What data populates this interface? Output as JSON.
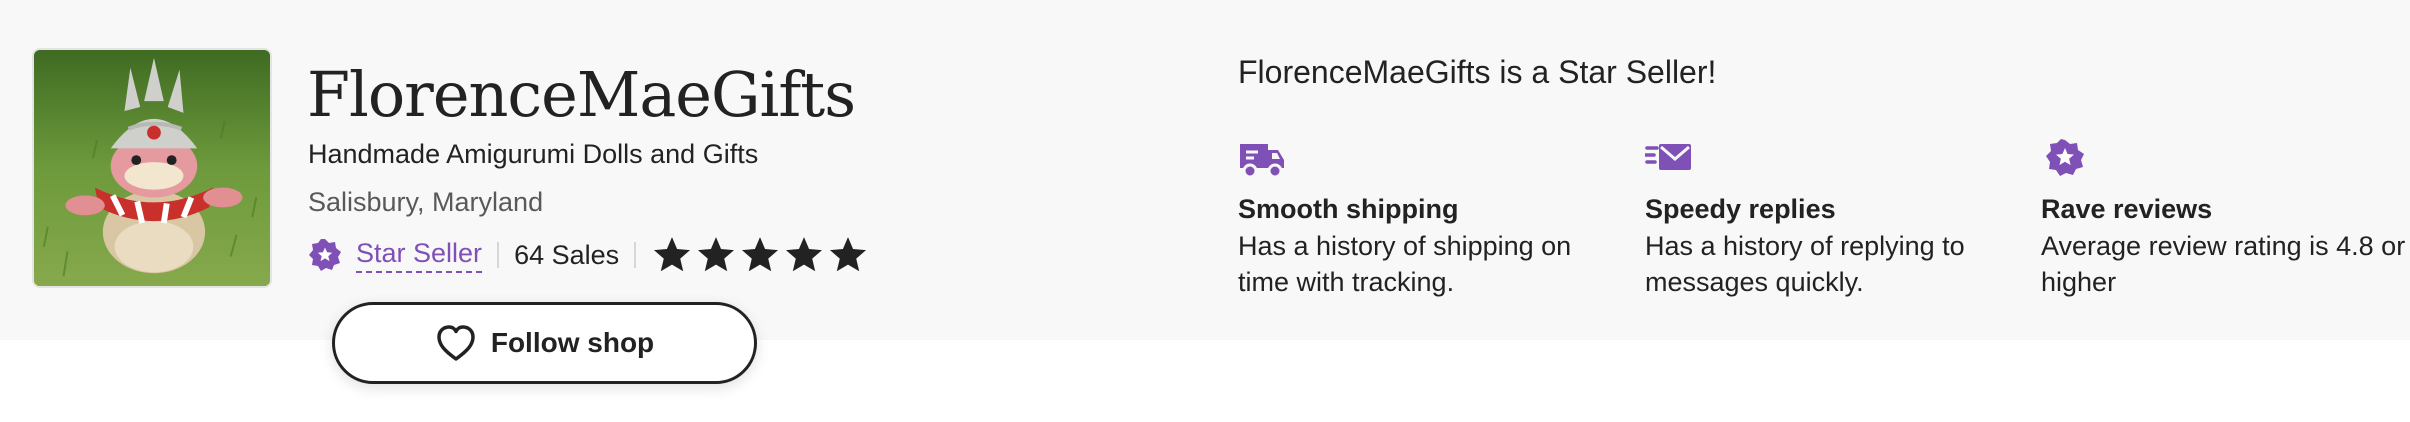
{
  "shop": {
    "name": "FlorenceMaeGifts",
    "tagline": "Handmade Amigurumi Dolls and Gifts",
    "location": "Salisbury, Maryland",
    "star_seller_label": "Star Seller",
    "sales": "64 Sales",
    "rating_stars": 5,
    "follow_label": "Follow shop"
  },
  "star_seller_panel": {
    "title": "FlorenceMaeGifts is a Star Seller!",
    "perks": [
      {
        "icon": "truck-icon",
        "title": "Smooth shipping",
        "description": "Has a history of shipping on time with tracking."
      },
      {
        "icon": "envelope-icon",
        "title": "Speedy replies",
        "description": "Has a history of replying to messages quickly."
      },
      {
        "icon": "star-badge-icon",
        "title": "Rave reviews",
        "description": "Average review rating is 4.8 or higher"
      }
    ]
  },
  "colors": {
    "accent_purple": "#7f50b5",
    "text": "#222222",
    "muted_text": "#595959",
    "header_background": "#f8f8f8"
  }
}
